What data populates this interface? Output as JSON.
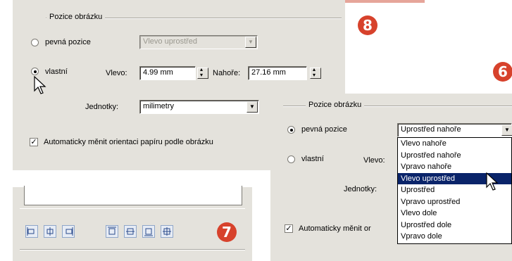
{
  "panel_a": {
    "group_title": "Pozice obrázku",
    "radio_fixed_label": "pevná pozice",
    "fixed_dropdown_value": "Vlevo uprostřed",
    "radio_custom_label": "vlastní",
    "left_label": "Vlevo:",
    "left_value": "4.99 mm",
    "top_label": "Nahoře:",
    "top_value": "27.16 mm",
    "units_label": "Jednotky:",
    "units_value": "milimetry",
    "auto_orient_label": "Automaticky měnit orientaci papíru podle obrázku",
    "badge": "8"
  },
  "panel_b": {
    "badge": "7",
    "buttons": [
      "align-left-icon",
      "align-center-h-icon",
      "align-right-icon",
      "align-top-icon",
      "align-center-v-icon",
      "align-bottom-icon",
      "align-center-icon"
    ]
  },
  "panel_c": {
    "group_title": "Pozice obrázku",
    "radio_fixed_label": "pevná pozice",
    "fixed_dropdown_value": "Uprostřed nahoře",
    "radio_custom_label": "vlastní",
    "left_label": "Vlevo:",
    "units_label": "Jednotky:",
    "auto_orient_label": "Automaticky měnit or",
    "options": [
      "Vlevo nahoře",
      "Uprostřed nahoře",
      "Vpravo nahoře",
      "Vlevo uprostřed",
      "Uprostřed",
      "Vpravo uprostřed",
      "Vlevo dole",
      "Uprostřed dole",
      "Vpravo dole"
    ],
    "selected_index": 3,
    "badge": "6"
  },
  "colors": {
    "panel_bg": "#e4e2dc",
    "badge": "#d7422c",
    "selection": "#0a246a"
  }
}
